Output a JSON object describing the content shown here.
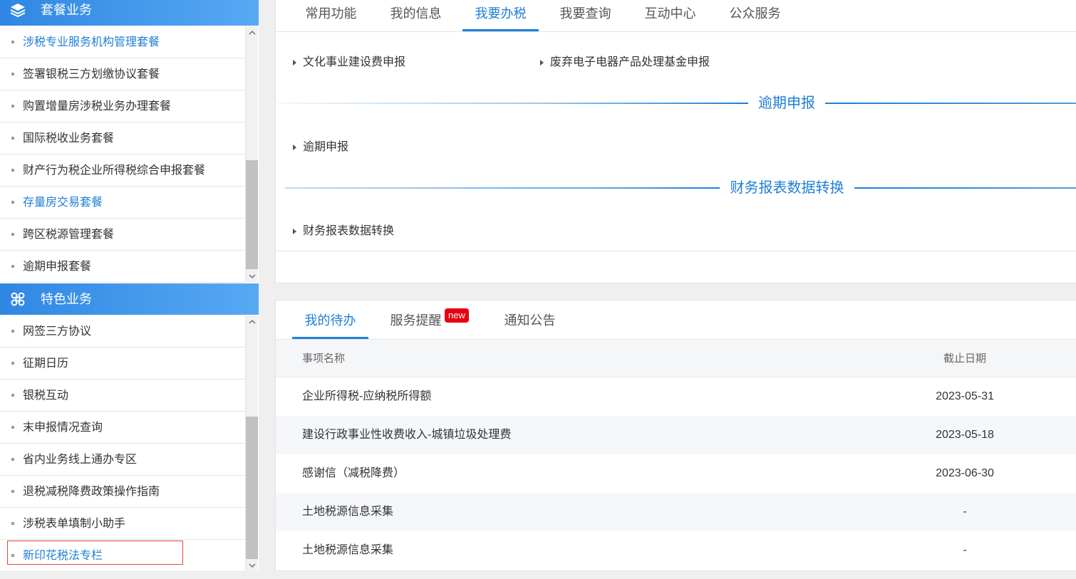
{
  "sidebar": {
    "packages": {
      "title": "套餐业务",
      "icon": "layers-icon",
      "items": [
        "涉税专业服务机构管理套餐",
        "签署银税三方划缴协议套餐",
        "购置增量房涉税业务办理套餐",
        "国际税收业务套餐",
        "财产行为税企业所得税综合申报套餐",
        "存量房交易套餐",
        "跨区税源管理套餐",
        "逾期申报套餐"
      ]
    },
    "features": {
      "title": "特色业务",
      "icon": "clover-icon",
      "items": [
        "网签三方协议",
        "征期日历",
        "银税互动",
        "末申报情况查询",
        "省内业务线上通办专区",
        "退税减税降费政策操作指南",
        "涉税表单填制小助手",
        "新印花税法专栏"
      ]
    }
  },
  "main_tabs": [
    {
      "label": "常用功能",
      "active": false
    },
    {
      "label": "我的信息",
      "active": false
    },
    {
      "label": "我要办税",
      "active": true
    },
    {
      "label": "我要查询",
      "active": false
    },
    {
      "label": "互动中心",
      "active": false
    },
    {
      "label": "公众服务",
      "active": false
    }
  ],
  "tax_functions": {
    "top_links": [
      "文化事业建设费申报",
      "废弃电子电器产品处理基金申报"
    ],
    "groups": [
      {
        "title": "逾期申报",
        "links": [
          "逾期申报"
        ]
      },
      {
        "title": "财务报表数据转换",
        "links": [
          "财务报表数据转换"
        ]
      }
    ]
  },
  "todo_panel": {
    "tabs": [
      {
        "label": "我的待办",
        "active": true
      },
      {
        "label": "服务提醒",
        "active": false,
        "badge": "new"
      },
      {
        "label": "通知公告",
        "active": false
      }
    ],
    "table": {
      "headers": [
        "事项名称",
        "截止日期"
      ],
      "rows": [
        {
          "name": "企业所得税-应纳税所得额",
          "deadline": "2023-05-31"
        },
        {
          "name": "建设行政事业性收费收入-城镇垃圾处理费",
          "deadline": "2023-05-18"
        },
        {
          "name": "感谢信（减税降费）",
          "deadline": "2023-06-30"
        },
        {
          "name": "土地税源信息采集",
          "deadline": "-"
        },
        {
          "name": "土地税源信息采集",
          "deadline": "-"
        }
      ]
    }
  },
  "colors": {
    "accent": "#1f7fd6",
    "header_gradient_start": "#2f87e3",
    "header_gradient_end": "#58a9f3",
    "badge": "#e60012",
    "highlight_border": "#e2473c"
  }
}
